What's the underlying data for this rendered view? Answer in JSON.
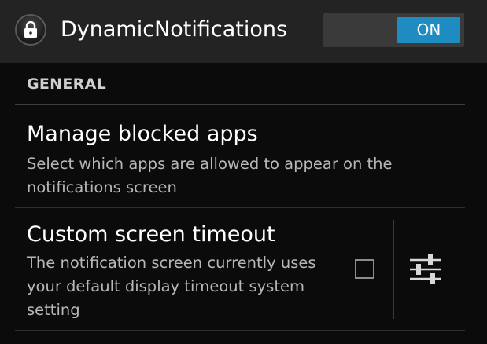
{
  "app": {
    "title": "DynamicNotifications",
    "icon": "lock-icon"
  },
  "master_switch": {
    "state": "ON",
    "accent_color": "#1e8cc0"
  },
  "section": {
    "header": "GENERAL"
  },
  "preferences": [
    {
      "title": "Manage blocked apps",
      "summary": "Select which apps are allowed to appear on the notifications screen"
    },
    {
      "title": "Custom screen timeout",
      "summary": "The notification screen currently uses your default display timeout system setting",
      "checked": false,
      "action_icon": "sliders-icon"
    }
  ]
}
